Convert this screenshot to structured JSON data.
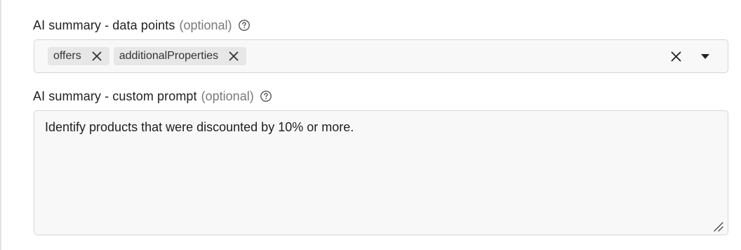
{
  "data_points_field": {
    "label": "AI summary - data points",
    "optional": "(optional)",
    "help_icon": "question-circle-icon",
    "selected": [
      {
        "label": "offers",
        "remove_icon": "close-icon"
      },
      {
        "label": "additionalProperties",
        "remove_icon": "close-icon"
      }
    ],
    "clear_icon": "close-icon",
    "dropdown_icon": "caret-down-icon"
  },
  "prompt_field": {
    "label": "AI summary - custom prompt",
    "optional": "(optional)",
    "help_icon": "question-circle-icon",
    "value": "Identify products that were discounted by 10% or more.",
    "resize_icon": "resize-handle-icon"
  },
  "colors": {
    "field_background": "#f8f8f8",
    "field_border": "#d6d6d6",
    "chip_background": "#e7e7e7",
    "muted_text": "#7a7a7a"
  }
}
